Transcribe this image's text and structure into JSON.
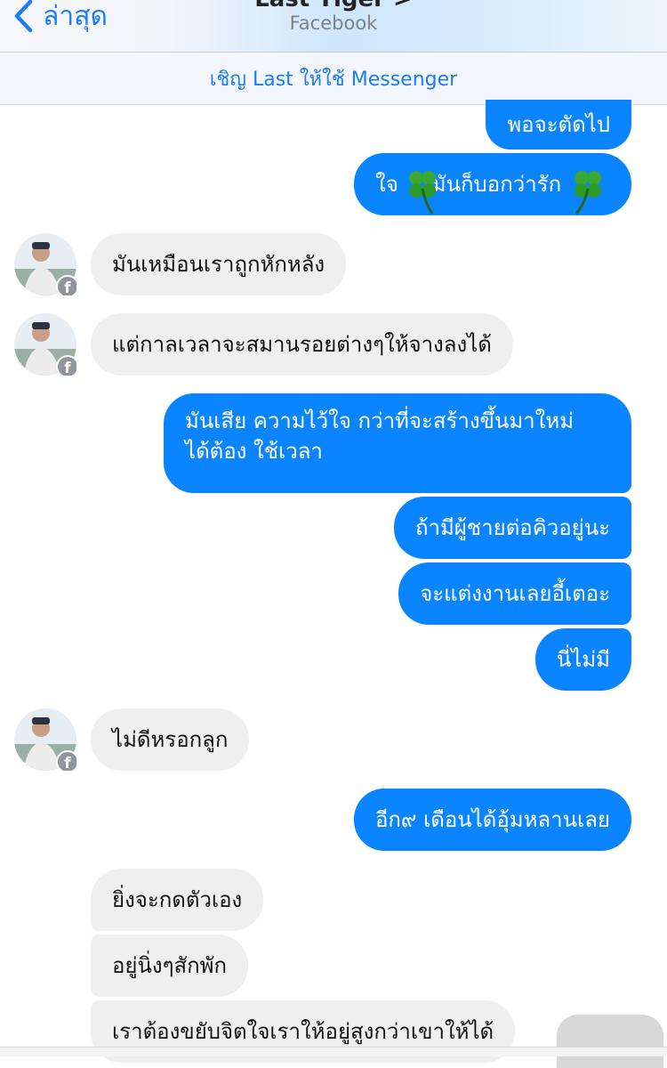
{
  "header": {
    "back_label": "ล่าสุด",
    "title": "Last Tiger >",
    "subtitle": "Facebook"
  },
  "invite_banner": {
    "text": "เชิญ Last ให้ใช้ Messenger"
  },
  "colors": {
    "accent": "#1b7cf6",
    "outgoing_bubble": "#0a84ff",
    "incoming_bubble": "#efefef"
  },
  "messages": [
    {
      "side": "out",
      "text": "พอจะตัดไป"
    },
    {
      "side": "out",
      "text": "ใจ🍀มันก็บอกว่ารัก🍀",
      "line1": "ใจ",
      "line2": "มันก็บอกว่ารัก"
    },
    {
      "side": "in",
      "text": "มันเหมือนเราถูกหักหลัง"
    },
    {
      "side": "in",
      "text": "แต่กาลเวลาจะสมานรอยต่างๆให้จางลงได้"
    },
    {
      "side": "out",
      "text": "มันเสีย ความไว้ใจ กว่าที่จะสร้างขึ้นมาใหม่ ได้ต้อง ใช้เวลา",
      "line1": "มันเสีย ความไว้ใจ กว่าที่จะสร้างขึ้นมาใหม่",
      "line2": "ได้ต้อง ใช้เวลา"
    },
    {
      "side": "out",
      "text": "ถ้ามีผู้ชายต่อคิวอยู่นะ"
    },
    {
      "side": "out",
      "text": "จะแต่งงานเลยอี้เตอะ"
    },
    {
      "side": "out",
      "text": "นี่ไม่มี"
    },
    {
      "side": "in",
      "text": "ไม่ดีหรอกลูก"
    },
    {
      "side": "out",
      "text": "อีก๙ เดือนได้อุ้มหลานเลย"
    },
    {
      "side": "in",
      "text": "ยิ่งจะกดตัวเอง"
    },
    {
      "side": "in",
      "text": "อยู่นิ่งๆสักพัก"
    },
    {
      "side": "in",
      "text": "เราต้องขยับจิตใจเราให้อยู่สูงกว่าเขาให้ได้"
    }
  ]
}
